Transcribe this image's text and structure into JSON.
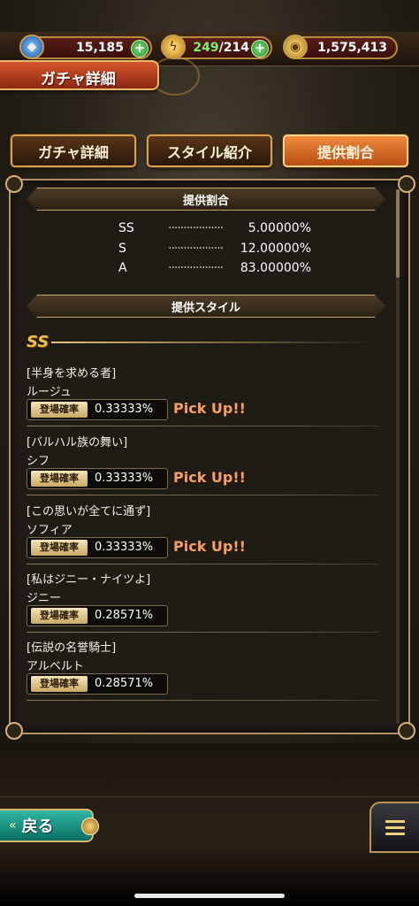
{
  "resources": {
    "gems": "15,185",
    "stamina_current": "249",
    "stamina_max": "/214",
    "gold": "1,575,413"
  },
  "page_title": "ガチャ詳細",
  "tabs": [
    {
      "label": "ガチャ詳細",
      "active": false
    },
    {
      "label": "スタイル紹介",
      "active": false
    },
    {
      "label": "提供割合",
      "active": true
    }
  ],
  "rates_section": {
    "title": "提供割合",
    "rows": [
      {
        "rank": "SS",
        "dots": "··················",
        "percent": "5.00000%"
      },
      {
        "rank": "S",
        "dots": "··················",
        "percent": "12.00000%"
      },
      {
        "rank": "A",
        "dots": "··················",
        "percent": "83.00000%"
      }
    ]
  },
  "styles_section": {
    "title": "提供スタイル",
    "rank_icon": "SS",
    "rate_label": "登場確率",
    "pickup_text": "Pick Up!!",
    "entries": [
      {
        "epithet": "[半身を求める者]",
        "name": "ルージュ",
        "rate": "0.33333%",
        "pickup": true
      },
      {
        "epithet": "[バルハル族の舞い]",
        "name": "シフ",
        "rate": "0.33333%",
        "pickup": true
      },
      {
        "epithet": "[この思いが全てに通ず]",
        "name": "ソフィア",
        "rate": "0.33333%",
        "pickup": true
      },
      {
        "epithet": "[私はジニー・ナイツよ]",
        "name": "ジニー",
        "rate": "0.28571%",
        "pickup": false
      },
      {
        "epithet": "[伝説の名誉騎士]",
        "name": "アルベルト",
        "rate": "0.28571%",
        "pickup": false
      }
    ]
  },
  "back_button": {
    "label": "戻る",
    "icon": "double-chevron-left-icon"
  },
  "menu_button": {
    "icon": "hamburger-menu-icon"
  },
  "colors": {
    "accent_orange": "#e57a33",
    "pickup": "#f1a267",
    "panel_border": "#b39160",
    "back_teal": "#1a9c8a"
  }
}
